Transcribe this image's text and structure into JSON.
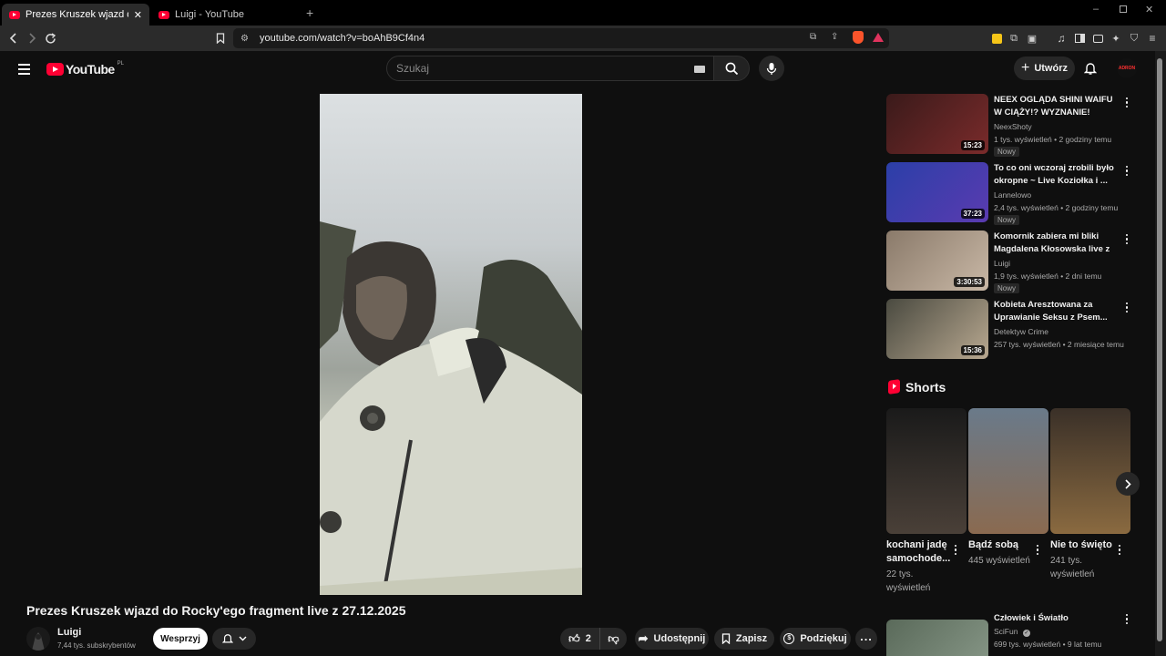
{
  "browser": {
    "tabs": [
      {
        "label": "Prezes Kruszek wjazd do Rocky'e",
        "active": true
      },
      {
        "label": "Luigi - YouTube",
        "active": false
      }
    ],
    "url": "youtube.com/watch?v=boAhB9Cf4n4"
  },
  "yt": {
    "logo_text": "YouTube",
    "region": "PL",
    "search_placeholder": "Szukaj",
    "create_label": "Utwórz",
    "avatar_text": "ADRON"
  },
  "video": {
    "title": "Prezes Kruszek wjazd do Rocky'ego fragment live z 27.12.2025",
    "channel": "Luigi",
    "subscribers": "7,44 tys. subskrybentów",
    "support_label": "Wesprzyj",
    "likes": "2",
    "share_label": "Udostępnij",
    "save_label": "Zapisz",
    "thanks_label": "Podziękuj"
  },
  "recommendations": [
    {
      "title": "NEEX OGLĄDA SHINI WAIFU W CIĄŻY!? WYZNANIE! MAMMO...",
      "channel": "NeexShoty",
      "meta": "1 tys. wyświetleń • 2 godziny temu",
      "badge": "Nowy",
      "duration": "15:23",
      "thumb_colors": [
        "#3a1a1a",
        "#7a2b2b"
      ]
    },
    {
      "title": "To co oni wczoraj zrobili było okropne ~ Live Koziołka i ...",
      "channel": "Lannelowo",
      "meta": "2,4 tys. wyświetleń • 2 godziny temu",
      "badge": "Nowy",
      "duration": "37:23",
      "thumb_colors": [
        "#2b3fa8",
        "#5a3bb0"
      ]
    },
    {
      "title": "Komornik zabiera mi bliki Magdalena Kłosowska live z ...",
      "channel": "Luigi",
      "meta": "1,9 tys. wyświetleń • 2 dni temu",
      "badge": "Nowy",
      "duration": "3:30:53",
      "thumb_colors": [
        "#8a7a6a",
        "#c9b8a6"
      ]
    },
    {
      "title": "Kobieta Aresztowana za Uprawianie Seksu z Psem...",
      "channel": "Detektyw Crime",
      "meta": "257 tys. wyświetleń • 2 miesiące temu",
      "badge": "",
      "duration": "15:36",
      "thumb_colors": [
        "#4a4a40",
        "#b8a890"
      ]
    }
  ],
  "shorts_heading": "Shorts",
  "shorts": [
    {
      "title": "kochani jadę samochode...",
      "views": "22 tys. wyświetleń",
      "thumb_colors": [
        "#1a1a1a",
        "#4a4038"
      ]
    },
    {
      "title": "Bądź sobą",
      "views": "445 wyświetleń",
      "thumb_colors": [
        "#6a7a8a",
        "#8a6a50"
      ]
    },
    {
      "title": "Nie to święto",
      "views": "241 tys. wyświetleń",
      "thumb_colors": [
        "#3a3028",
        "#8a6a40"
      ]
    }
  ],
  "last_rec": {
    "title": "Człowiek i Światło",
    "channel": "SciFun",
    "meta": "699 tys. wyświetleń • 9 lat temu",
    "thumb_colors": [
      "#5a6a5a",
      "#8a9a8a"
    ]
  }
}
